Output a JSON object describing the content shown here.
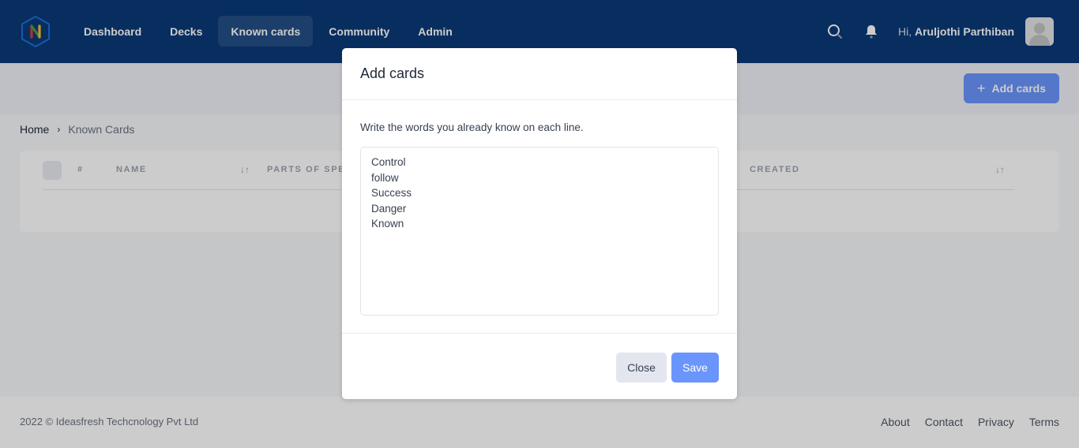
{
  "header": {
    "logo_letter": "N",
    "nav": [
      {
        "label": "Dashboard",
        "active": false
      },
      {
        "label": "Decks",
        "active": false
      },
      {
        "label": "Known cards",
        "active": true
      },
      {
        "label": "Community",
        "active": false
      },
      {
        "label": "Admin",
        "active": false
      }
    ],
    "greeting_prefix": "Hi,",
    "user_name": "Aruljothi Parthiban",
    "icons": [
      "search-icon",
      "bell-icon",
      "avatar"
    ]
  },
  "toolbar": {
    "add_cards_label": "Add cards",
    "add_icon": "+"
  },
  "breadcrumb": {
    "home": "Home",
    "separator": "›",
    "current": "Known Cards"
  },
  "table": {
    "columns": [
      {
        "label": "#"
      },
      {
        "label": "NAME",
        "sortable": true
      },
      {
        "label": "PARTS OF SPEECH"
      },
      {
        "label": "CREATED",
        "sortable": true
      }
    ],
    "sort_icon": "↓↑",
    "rows": []
  },
  "modal": {
    "title": "Add cards",
    "hint": "Write the words you already know on each line.",
    "textarea_value": "Control\nfollow\nSuccess\nDanger\nKnown",
    "close_label": "Close",
    "save_label": "Save"
  },
  "footer": {
    "copyright": "2022 © Ideasfresh Techcnology Pvt Ltd",
    "links": [
      "About",
      "Contact",
      "Privacy",
      "Terms"
    ]
  },
  "colors": {
    "header_bg": "#0b3a78",
    "primary": "#6a95fd",
    "overlay": "rgba(0,0,0,0.2)"
  }
}
